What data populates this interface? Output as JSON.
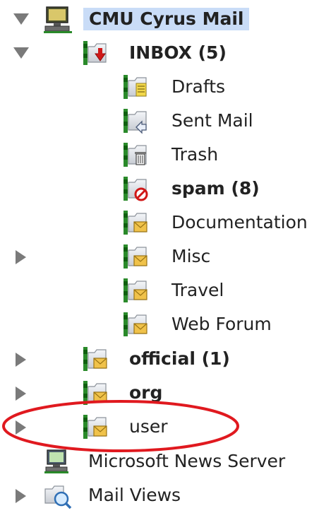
{
  "tree": {
    "server": {
      "label": "CMU Cyrus Mail",
      "icon": "server-computer-icon"
    },
    "inbox": {
      "label": "INBOX (5)",
      "icon": "inbox-folder-icon"
    },
    "inbox_children": [
      {
        "label": "Drafts",
        "icon": "drafts-folder-icon"
      },
      {
        "label": "Sent Mail",
        "icon": "sent-folder-icon"
      },
      {
        "label": "Trash",
        "icon": "trash-folder-icon"
      },
      {
        "label": "spam (8)",
        "icon": "spam-folder-icon"
      },
      {
        "label": "Documentation",
        "icon": "mail-folder-icon"
      },
      {
        "label": "Misc",
        "icon": "mail-folder-icon"
      },
      {
        "label": "Travel",
        "icon": "mail-folder-icon"
      },
      {
        "label": "Web Forum",
        "icon": "mail-folder-icon"
      }
    ],
    "top_folders": [
      {
        "label": "official (1)",
        "icon": "mail-folder-icon"
      },
      {
        "label": "org",
        "icon": "mail-folder-icon"
      },
      {
        "label": "user",
        "icon": "mail-folder-icon"
      }
    ],
    "news": {
      "label": "Microsoft News Server",
      "icon": "news-server-icon"
    },
    "views": {
      "label": "Mail Views",
      "icon": "mail-views-icon"
    }
  },
  "colors": {
    "selection": "#c9dcf7",
    "annotation": "#e0191f",
    "expander": "#7a7a7a"
  }
}
